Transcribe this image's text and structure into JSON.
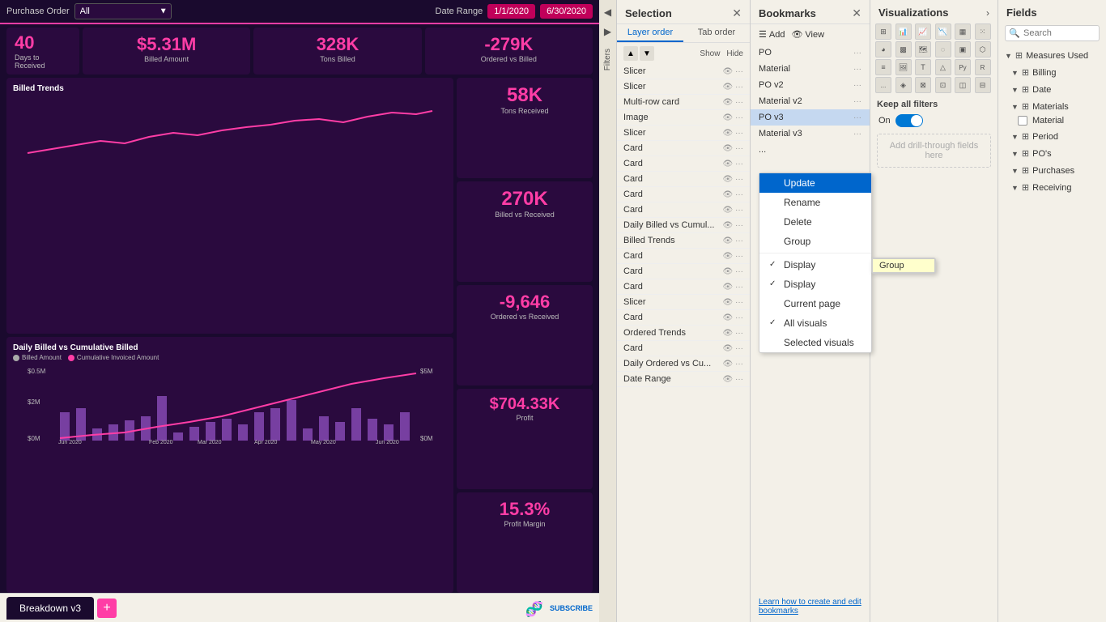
{
  "dashboard": {
    "background": "#1a0a2e",
    "po_filter_label": "Purchase Order",
    "po_filter_value": "All",
    "date_range_label": "Date Range",
    "date_start": "1/1/2020",
    "date_end": "6/30/2020",
    "kpis_top": [
      {
        "id": "billed-amount",
        "value": "$5.31M",
        "label": "Billed Amount"
      },
      {
        "id": "tons-billed",
        "value": "328K",
        "label": "Tons Billed"
      },
      {
        "id": "ordered-vs-billed",
        "value": "-279K",
        "label": "Ordered vs Billed"
      }
    ],
    "kpi_top_left": {
      "value": "40",
      "label": "Days"
    },
    "kpi_tons_received": {
      "value": "58K",
      "label": "Tons Received"
    },
    "kpi_billed_vs_received": {
      "value": "270K",
      "label": "Billed vs Received"
    },
    "kpi_ordered_vs_received": {
      "value": "-9,646",
      "label": "Ordered vs Received"
    },
    "kpi_profit": {
      "value": "$704.33K",
      "label": "Profit"
    },
    "kpi_profit_margin": {
      "value": "15.3%",
      "label": "Profit Margin"
    },
    "billed_trends_title": "Billed Trends",
    "daily_billed_title": "Daily Billed vs Cumulative Billed",
    "legend_billed_amount": "Billed Amount",
    "legend_cumulative": "Cumulative Invoiced Amount",
    "tab_name": "Breakdown v3",
    "tab_add_label": "+"
  },
  "selection_panel": {
    "title": "Selection",
    "close_icon": "✕",
    "tab_layer": "Layer order",
    "tab_tab": "Tab order",
    "show_label": "Show",
    "hide_label": "Hide",
    "items": [
      {
        "name": "Slicer",
        "highlighted": false
      },
      {
        "name": "Slicer",
        "highlighted": false
      },
      {
        "name": "Multi-row card",
        "highlighted": false
      },
      {
        "name": "Image",
        "highlighted": false
      },
      {
        "name": "Slicer",
        "highlighted": false
      },
      {
        "name": "Card",
        "highlighted": false
      },
      {
        "name": "Card",
        "highlighted": false
      },
      {
        "name": "Card",
        "highlighted": false
      },
      {
        "name": "Card",
        "highlighted": false
      },
      {
        "name": "Card",
        "highlighted": false
      },
      {
        "name": "Daily Billed vs Cumul...",
        "highlighted": false
      },
      {
        "name": "Billed Trends",
        "highlighted": false
      },
      {
        "name": "Card",
        "highlighted": false
      },
      {
        "name": "Card",
        "highlighted": false
      },
      {
        "name": "Card",
        "highlighted": false
      },
      {
        "name": "Slicer",
        "highlighted": false
      },
      {
        "name": "Card",
        "highlighted": false
      },
      {
        "name": "Ordered Trends",
        "highlighted": false
      },
      {
        "name": "Card",
        "highlighted": false
      },
      {
        "name": "Daily Ordered vs Cu...",
        "highlighted": false
      },
      {
        "name": "Date Range",
        "highlighted": false
      }
    ]
  },
  "bookmarks_panel": {
    "title": "Bookmarks",
    "close_icon": "✕",
    "add_label": "Add",
    "view_label": "View",
    "items": [
      {
        "name": "PO",
        "highlighted": false
      },
      {
        "name": "Material",
        "highlighted": false
      },
      {
        "name": "PO v2",
        "highlighted": false
      },
      {
        "name": "Material v2",
        "highlighted": false
      },
      {
        "name": "PO v3",
        "highlighted": true
      },
      {
        "name": "Material v3",
        "highlighted": false
      },
      {
        "name": "...",
        "highlighted": false
      }
    ],
    "learn_link": "Learn how to create and edit bookmarks"
  },
  "context_menu": {
    "items": [
      {
        "label": "Update",
        "active": true,
        "check": ""
      },
      {
        "label": "Rename",
        "active": false,
        "check": ""
      },
      {
        "label": "Delete",
        "active": false,
        "check": ""
      },
      {
        "label": "Group",
        "active": false,
        "check": ""
      }
    ],
    "sub_items": [
      {
        "label": "Display",
        "checked": true
      },
      {
        "label": "Display",
        "checked": false
      },
      {
        "label": "Current page",
        "checked": false
      },
      {
        "label": "All visuals",
        "checked": true
      },
      {
        "label": "Selected visuals",
        "checked": false
      }
    ],
    "tooltip_label": "Group"
  },
  "visualizations_panel": {
    "title": "Visualizations",
    "icons": [
      "📊",
      "📈",
      "📉",
      "🗃",
      "📋",
      "🗂",
      "📌",
      "📐",
      "🔲",
      "📏",
      "🔷",
      "🔶",
      "🔸",
      "🔹",
      "🔺",
      "⬛",
      "🔘",
      "📦",
      "📑",
      "⬡",
      "⬢",
      "🔔",
      "📎",
      "🔗",
      "🔳",
      "⬜",
      "🔄",
      "🔃",
      "📁",
      "📂"
    ]
  },
  "fields_panel": {
    "title": "Fields",
    "search_placeholder": "Search",
    "groups": [
      {
        "name": "Measures Used",
        "icon": "⊞",
        "expanded": true,
        "items": [
          {
            "name": "Billing",
            "checked": false
          },
          {
            "name": "Date",
            "checked": false
          },
          {
            "name": "Materials",
            "checked": false,
            "sub": [
              {
                "name": "Material",
                "checked": false
              }
            ]
          },
          {
            "name": "Period",
            "checked": false
          },
          {
            "name": "PO's",
            "checked": false
          },
          {
            "name": "Purchases",
            "checked": false
          },
          {
            "name": "Receiving",
            "checked": false
          }
        ]
      }
    ]
  },
  "keep_filters": {
    "label": "Keep all filters",
    "toggle": "On"
  },
  "drill_through": {
    "label": "Add drill-through fields here"
  },
  "filters_panel": {
    "label": "Filters"
  }
}
